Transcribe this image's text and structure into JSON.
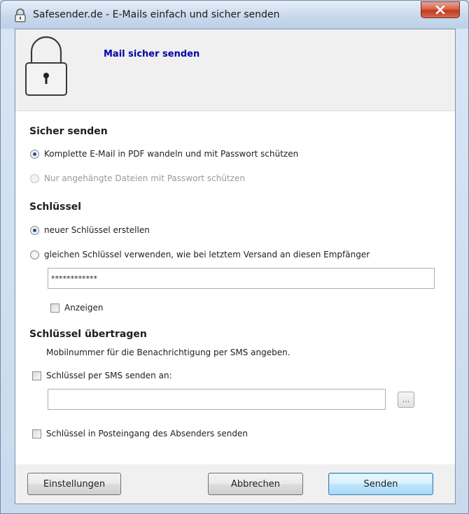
{
  "window": {
    "title": "Safesender.de - E-Mails einfach und sicher senden",
    "close_label": "x"
  },
  "header": {
    "title": "Mail sicher senden",
    "icon": "padlock-icon"
  },
  "secure_send": {
    "title": "Sicher senden",
    "options": [
      {
        "label": "Komplette E-Mail in PDF wandeln und mit Passwort schützen",
        "checked": true,
        "disabled": false
      },
      {
        "label": "Nur angehängte Dateien mit Passwort schützen",
        "checked": false,
        "disabled": true
      }
    ]
  },
  "key": {
    "title": "Schlüssel",
    "options": [
      {
        "label": "neuer Schlüssel erstellen",
        "checked": true
      },
      {
        "label": "gleichen Schlüssel verwenden, wie bei letztem Versand an diesen Empfänger",
        "checked": false
      }
    ],
    "password_value": "************",
    "show_label": "Anzeigen",
    "show_checked": false
  },
  "transfer": {
    "title": "Schlüssel übertragen",
    "hint": "Mobilnummer für die Benachrichtigung per SMS angeben.",
    "sms_label": "Schlüssel per SMS senden an:",
    "sms_checked": false,
    "phone_value": "",
    "browse_label": "...",
    "inbox_label": "Schlüssel in Posteingang des Absenders senden",
    "inbox_checked": false
  },
  "footer": {
    "settings_label": "Einstellungen",
    "cancel_label": "Abbrechen",
    "send_label": "Senden"
  }
}
